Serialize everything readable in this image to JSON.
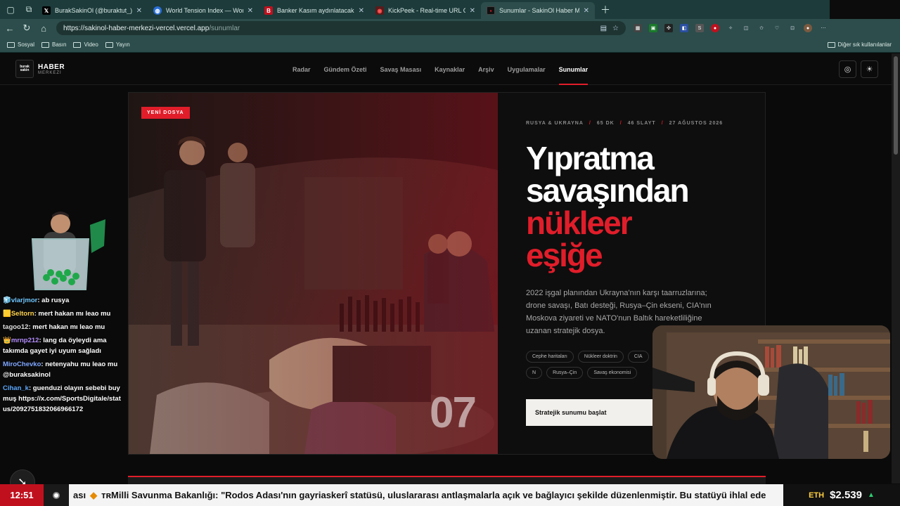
{
  "browser": {
    "tabs": [
      {
        "title": "BurakSakinOl (@buraktut_) / X",
        "icon": "x-logo-icon",
        "active": false
      },
      {
        "title": "World Tension Index — World Tens",
        "icon": "globe-icon",
        "active": false
      },
      {
        "title": "Banker Kasım aydınlatacak!",
        "icon": "b-logo-icon",
        "active": false
      },
      {
        "title": "KickPeek - Real-time URL Crawler",
        "icon": "kickpeek-icon",
        "active": false
      },
      {
        "title": "Sunumlar - SakinOl Haber Merkezi",
        "icon": "site-favicon-icon",
        "active": true
      }
    ],
    "url_host": "https://sakinol-haber-merkezi-vercel.vercel.app",
    "url_path": "/sunumlar",
    "bookmarks": [
      "Sosyal",
      "Basın",
      "Video",
      "Yayın"
    ],
    "other_bookmarks": "Diğer sık kullanılanlar"
  },
  "site": {
    "logo_line1": "HABER",
    "logo_line2": "MERKEZİ",
    "logo_mark": "burak sakin",
    "nav": [
      "Radar",
      "Gündem Özeti",
      "Savaş Masası",
      "Kaynaklar",
      "Arşiv",
      "Uygulamalar",
      "Sunumlar"
    ],
    "active_nav": "Sunumlar"
  },
  "feature": {
    "badge": "YENİ DOSYA",
    "number": "07",
    "meta": [
      "RUSYA & UKRAYNA",
      "65 DK",
      "46 SLAYT",
      "27 AĞUSTOS 2026"
    ],
    "title_white": [
      "Yıpratma",
      "savaşından"
    ],
    "title_red": [
      "nükleer",
      "eşiğe"
    ],
    "description": "2022 işgal planından Ukrayna'nın karşı taarruzlarına; drone savaşı, Batı desteği, Rusya–Çin ekseni, CIA'nın Moskova ziyareti ve NATO'nun Baltık hareketliliğine uzanan stratejik dosya.",
    "tags": [
      "Cephe haritaları",
      "Nükleer doktrin",
      "CIA",
      "N",
      "Rusya–Çin",
      "Savaş ekonomisi"
    ],
    "cta": "Stratejik sunumu başlat"
  },
  "chat": [
    {
      "user": "vlarjmor",
      "text": "ab rusya"
    },
    {
      "user": "Seltorn",
      "text": "mert hakan mı leao mu"
    },
    {
      "user": "tagoo12",
      "text": "mert hakan mı leao mu"
    },
    {
      "user": "mrnp212",
      "text": "lang da öyleydi ama takımda gayet iyi uyum sağladı"
    },
    {
      "user": "MiroChevko",
      "text": "netenyahu mu leao mu @buraksakinol"
    },
    {
      "user": "Cihan_k",
      "text": "guenduzi olayın sebebi buymuş https://x.com/SportsDigitale/status/2092751832066966172"
    }
  ],
  "ticker": {
    "time": "12:51",
    "prefix": "ası",
    "text": "Milli Savunma Bakanlığı: \"Rodos Adası'nın gayriaskerî statüsü, uluslararası antlaşmalarla açık ve bağlayıcı şekilde düzenlenmiştir. Bu statüyü ihlal ede",
    "crypto_symbol": "ETH",
    "crypto_value": "$2.539"
  },
  "colors": {
    "accent": "#e11d2a",
    "browser": "#2c4d4b"
  }
}
